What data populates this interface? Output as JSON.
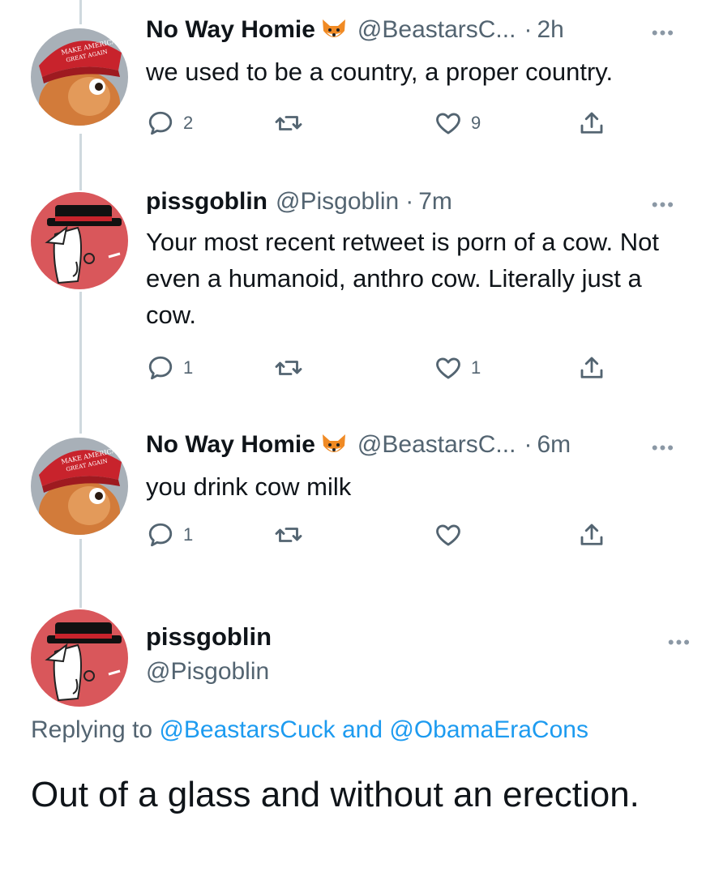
{
  "tweets": [
    {
      "name": "No Way Homie",
      "handle": "@BeastarsC...",
      "time": "2h",
      "text": "we used to be a country, a proper country.",
      "replies": "2",
      "retweets": "",
      "likes": "9"
    },
    {
      "name": "pissgoblin",
      "handle": "@Pisgoblin",
      "time": "7m",
      "text": "Your most recent retweet is porn of a cow. Not even a humanoid, anthro cow. Literally just a cow.",
      "replies": "1",
      "retweets": "",
      "likes": "1"
    },
    {
      "name": "No Way Homie",
      "handle": "@BeastarsC...",
      "time": "6m",
      "text": "you drink cow milk",
      "replies": "1",
      "retweets": "",
      "likes": ""
    }
  ],
  "main_tweet": {
    "name": "pissgoblin",
    "handle": "@Pisgoblin",
    "replying_prefix": "Replying to",
    "reply_user_1": "@BeastarsCuck",
    "reply_and": "and",
    "reply_user_2": "@ObamaEraCons",
    "text": "Out of a glass and without an erection."
  },
  "ui": {
    "separator_dot": "·",
    "more_glyph": "•••"
  },
  "icons": {
    "reply": "reply-icon",
    "retweet": "retweet-icon",
    "like": "heart-icon",
    "share": "share-icon",
    "fox": "fox-emoji-icon"
  },
  "colors": {
    "text": "#0f1419",
    "secondary": "#536471",
    "link": "#1d9bf0",
    "thread_line": "#cfd9de"
  }
}
